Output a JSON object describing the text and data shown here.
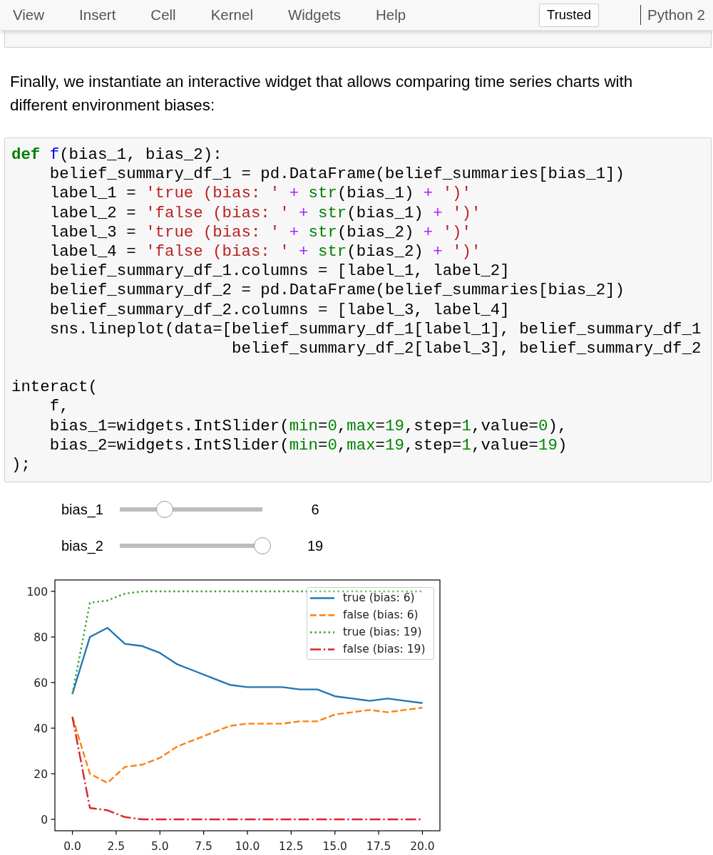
{
  "menu": {
    "items": [
      "View",
      "Insert",
      "Cell",
      "Kernel",
      "Widgets",
      "Help"
    ],
    "trusted": "Trusted",
    "kernel": "Python 2"
  },
  "markdown": "Finally, we instantiate an interactive widget that allows comparing time series charts with different environment biases:",
  "code_cell": {
    "blocks": [
      {
        "lines": [
          [
            {
              "kind": "keyword",
              "text": "def"
            },
            {
              "kind": "function",
              "text": " f"
            },
            {
              "kind": "plain",
              "text": "(bias_1, bias_2):"
            }
          ],
          [
            {
              "kind": "plain",
              "text": "    belief_summary_df_1 = pd.DataFrame(belief_summaries[bias_1])"
            }
          ],
          [
            {
              "kind": "plain",
              "text": "    label_1 = "
            },
            {
              "kind": "string",
              "text": "'true (bias: '"
            },
            {
              "kind": "operator",
              "text": " + "
            },
            {
              "kind": "builtin",
              "text": "str"
            },
            {
              "kind": "plain",
              "text": "(bias_1) "
            },
            {
              "kind": "operator",
              "text": "+ "
            },
            {
              "kind": "string",
              "text": "')'"
            }
          ],
          [
            {
              "kind": "plain",
              "text": "    label_2 = "
            },
            {
              "kind": "string",
              "text": "'false (bias: '"
            },
            {
              "kind": "operator",
              "text": " + "
            },
            {
              "kind": "builtin",
              "text": "str"
            },
            {
              "kind": "plain",
              "text": "(bias_1) "
            },
            {
              "kind": "operator",
              "text": "+ "
            },
            {
              "kind": "string",
              "text": "')'"
            }
          ],
          [
            {
              "kind": "plain",
              "text": "    label_3 = "
            },
            {
              "kind": "string",
              "text": "'true (bias: '"
            },
            {
              "kind": "operator",
              "text": " + "
            },
            {
              "kind": "builtin",
              "text": "str"
            },
            {
              "kind": "plain",
              "text": "(bias_2) "
            },
            {
              "kind": "operator",
              "text": "+ "
            },
            {
              "kind": "string",
              "text": "')'"
            }
          ],
          [
            {
              "kind": "plain",
              "text": "    label_4 = "
            },
            {
              "kind": "string",
              "text": "'false (bias: '"
            },
            {
              "kind": "operator",
              "text": " + "
            },
            {
              "kind": "builtin",
              "text": "str"
            },
            {
              "kind": "plain",
              "text": "(bias_2) "
            },
            {
              "kind": "operator",
              "text": "+ "
            },
            {
              "kind": "string",
              "text": "')'"
            }
          ],
          [
            {
              "kind": "plain",
              "text": "    belief_summary_df_1.columns = [label_1, label_2]"
            }
          ],
          [
            {
              "kind": "plain",
              "text": "    belief_summary_df_2 = pd.DataFrame(belief_summaries[bias_2])"
            }
          ],
          [
            {
              "kind": "plain",
              "text": "    belief_summary_df_2.columns = [label_3, label_4]"
            }
          ],
          [
            {
              "kind": "plain",
              "text": "    sns.lineplot(data=[belief_summary_df_1[label_1], belief_summary_df_1"
            }
          ],
          [
            {
              "kind": "plain",
              "text": "                       belief_summary_df_2[label_3], belief_summary_df_2"
            }
          ]
        ]
      },
      {
        "lines": [
          [
            {
              "kind": "plain",
              "text": "interact("
            }
          ],
          [
            {
              "kind": "plain",
              "text": "    f,"
            }
          ],
          [
            {
              "kind": "plain",
              "text": "    bias_1=widgets.IntSlider("
            },
            {
              "kind": "builtin",
              "text": "min"
            },
            {
              "kind": "plain",
              "text": "="
            },
            {
              "kind": "number",
              "text": "0"
            },
            {
              "kind": "plain",
              "text": ","
            },
            {
              "kind": "builtin",
              "text": "max"
            },
            {
              "kind": "plain",
              "text": "="
            },
            {
              "kind": "number",
              "text": "19"
            },
            {
              "kind": "plain",
              "text": ",step="
            },
            {
              "kind": "number",
              "text": "1"
            },
            {
              "kind": "plain",
              "text": ",value="
            },
            {
              "kind": "number",
              "text": "0"
            },
            {
              "kind": "plain",
              "text": "),"
            }
          ],
          [
            {
              "kind": "plain",
              "text": "    bias_2=widgets.IntSlider("
            },
            {
              "kind": "builtin",
              "text": "min"
            },
            {
              "kind": "plain",
              "text": "="
            },
            {
              "kind": "number",
              "text": "0"
            },
            {
              "kind": "plain",
              "text": ","
            },
            {
              "kind": "builtin",
              "text": "max"
            },
            {
              "kind": "plain",
              "text": "="
            },
            {
              "kind": "number",
              "text": "19"
            },
            {
              "kind": "plain",
              "text": ",step="
            },
            {
              "kind": "number",
              "text": "1"
            },
            {
              "kind": "plain",
              "text": ",value="
            },
            {
              "kind": "number",
              "text": "19"
            },
            {
              "kind": "plain",
              "text": ")"
            }
          ],
          [
            {
              "kind": "plain",
              "text": ");"
            }
          ]
        ]
      }
    ]
  },
  "sliders": [
    {
      "label": "bias_1",
      "level": 0.316,
      "reading": "6"
    },
    {
      "label": "bias_2",
      "level": 1,
      "reading": "19"
    }
  ],
  "chart": {
    "chart_data": {
      "type": "line",
      "x": [
        0,
        1,
        2,
        3,
        4,
        5,
        6,
        7,
        8,
        9,
        10,
        11,
        12,
        13,
        14,
        15,
        16,
        17,
        18,
        19,
        20
      ],
      "series": [
        {
          "name": "true (bias: 6)",
          "color": "#1f77b4",
          "line_style": "solid",
          "values": [
            55,
            80,
            84,
            77,
            76,
            73,
            68,
            65,
            62,
            59,
            58,
            58,
            58,
            57,
            57,
            54,
            53,
            52,
            53,
            52,
            51
          ]
        },
        {
          "name": "false (bias: 6)",
          "color": "#ff7f0e",
          "line_style": "dashed",
          "values": [
            45,
            20,
            16,
            23,
            24,
            27,
            32,
            35,
            38,
            41,
            42,
            42,
            42,
            43,
            43,
            46,
            47,
            48,
            47,
            48,
            49
          ]
        },
        {
          "name": "true (bias: 19)",
          "color": "#2ca02c",
          "line_style": "dotted",
          "values": [
            55,
            95,
            96,
            99,
            100,
            100,
            100,
            100,
            100,
            100,
            100,
            100,
            100,
            100,
            100,
            100,
            100,
            100,
            100,
            100,
            100
          ]
        },
        {
          "name": "false (bias: 19)",
          "color": "#d62728",
          "line_style": "dashdot",
          "values": [
            45,
            5,
            4,
            1,
            0,
            0,
            0,
            0,
            0,
            0,
            0,
            0,
            0,
            0,
            0,
            0,
            0,
            0,
            0,
            0,
            0
          ]
        }
      ],
      "legend": true,
      "xlim": [
        -1,
        21
      ],
      "ylim": [
        -5,
        105
      ],
      "xticks": [
        {
          "value": 0,
          "label": "0.0"
        },
        {
          "value": 2.5,
          "label": "2.5"
        },
        {
          "value": 5,
          "label": "5.0"
        },
        {
          "value": 7.5,
          "label": "7.5"
        },
        {
          "value": 10,
          "label": "10.0"
        },
        {
          "value": 12.5,
          "label": "12.5"
        },
        {
          "value": 15,
          "label": "15.0"
        },
        {
          "value": 17.5,
          "label": "17.5"
        },
        {
          "value": 20,
          "label": "20.0"
        }
      ],
      "yticks": [
        {
          "value": 0,
          "label": "0"
        },
        {
          "value": 20,
          "label": "20"
        },
        {
          "value": 40,
          "label": "40"
        },
        {
          "value": 60,
          "label": "60"
        },
        {
          "value": 80,
          "label": "80"
        },
        {
          "value": 100,
          "label": "100"
        }
      ]
    }
  }
}
